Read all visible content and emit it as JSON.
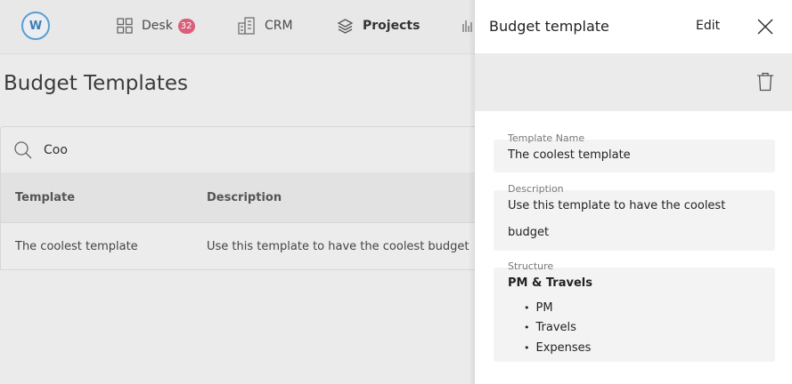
{
  "nav": {
    "logo_letter": "W",
    "items": [
      {
        "label": "Desk",
        "icon": "grid-icon",
        "badge": "32"
      },
      {
        "label": "CRM",
        "icon": "building-icon"
      },
      {
        "label": "Projects",
        "icon": "layers-icon"
      }
    ]
  },
  "page": {
    "title": "Budget Templates",
    "search": {
      "value": "Coo",
      "placeholder": ""
    },
    "table": {
      "headers": [
        "Template",
        "Description"
      ],
      "rows": [
        {
          "template": "The coolest template",
          "description": "Use this template to have the coolest budget"
        }
      ]
    }
  },
  "panel": {
    "title": "Budget template",
    "edit_label": "Edit",
    "fields": {
      "name_label": "Template Name",
      "name_value": "The coolest template",
      "description_label": "Description",
      "description_line1": "Use this template to have the coolest",
      "description_line2": "budget",
      "structure_label": "Structure",
      "structure_title": "PM & Travels",
      "structure_items": [
        "PM",
        "Travels",
        "Expenses"
      ]
    }
  },
  "colors": {
    "accent": "#5a9fd0",
    "badge": "#d9607a",
    "panel_bg": "#ffffff",
    "page_bg": "#ebebeb"
  }
}
